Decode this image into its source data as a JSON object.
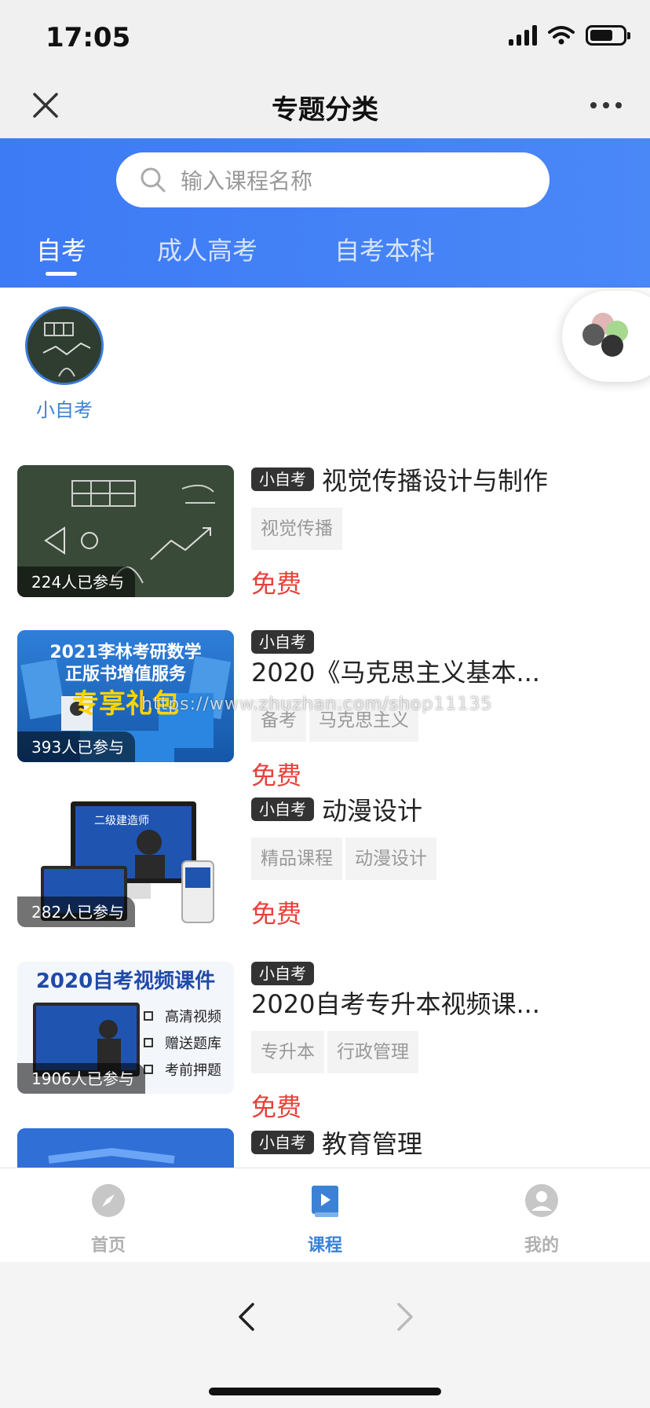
{
  "status_bar": {
    "time": "17:05"
  },
  "nav": {
    "title": "专题分类"
  },
  "search": {
    "placeholder": "输入课程名称"
  },
  "tabs": [
    {
      "label": "自考",
      "active": true
    },
    {
      "label": "成人高考",
      "active": false
    },
    {
      "label": "自考本科",
      "active": false
    }
  ],
  "category": {
    "label": "小自考"
  },
  "courses": [
    {
      "participants": "224人已参与",
      "badge": "小自考",
      "title": "视觉传播设计与制作",
      "tags": [
        "视觉传播"
      ],
      "price": "免费"
    },
    {
      "participants": "393人已参与",
      "badge": "小自考",
      "title": "2020《马克思主义基本...",
      "tags": [
        "备考",
        "马克思主义"
      ],
      "price": "免费"
    },
    {
      "participants": "282人已参与",
      "badge": "小自考",
      "title": "动漫设计",
      "tags": [
        "精品课程",
        "动漫设计"
      ],
      "price": "免费"
    },
    {
      "participants": "1906人已参与",
      "badge": "小自考",
      "title": "2020自考专升本视频课...",
      "tags": [
        "专升本",
        "行政管理"
      ],
      "price": "免费"
    },
    {
      "participants": "",
      "badge": "小自考",
      "title": "教育管理",
      "tags": [],
      "price": ""
    }
  ],
  "thumb_text": {
    "c2_line1": "2021李林考研数学",
    "c2_line2": "正版书增值服务",
    "c2_line3": "专享礼包",
    "c3_line1": "二级建造师",
    "c4_title": "2020自考视频课件",
    "c4_items": [
      "高清视频",
      "赠送题库",
      "考前押题"
    ]
  },
  "watermark": "https://www.zhuzhan.com/shop11135",
  "tabbar": [
    {
      "label": "首页",
      "icon": "compass-icon",
      "active": false
    },
    {
      "label": "课程",
      "icon": "book-icon",
      "active": true
    },
    {
      "label": "我的",
      "icon": "profile-icon",
      "active": false
    }
  ],
  "colors": {
    "accent": "#3b82d6",
    "header_blue": "#4a87f7",
    "price_red": "#e8403a"
  }
}
